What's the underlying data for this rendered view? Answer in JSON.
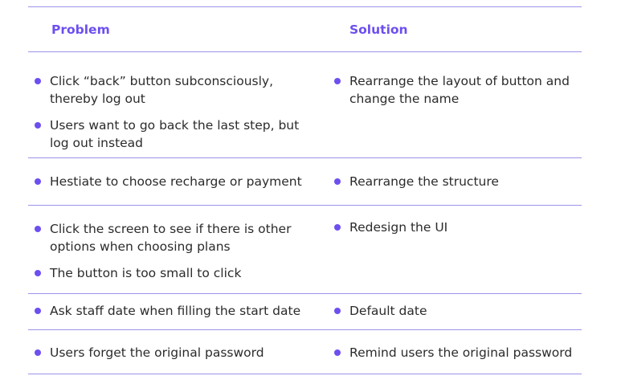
{
  "header": {
    "problem": "Problem",
    "solution": "Solution"
  },
  "rows": [
    {
      "problems": [
        "Click “back” button subconsciously, thereby log out",
        "Users want to go back the last step, but log out instead"
      ],
      "solutions": [
        "Rearrange the layout of button and change the name"
      ]
    },
    {
      "problems": [
        "Hestiate to choose recharge or payment"
      ],
      "solutions": [
        "Rearrange the structure"
      ]
    },
    {
      "problems": [
        "Click the screen to see if there is other options when choosing plans",
        "The button is too small to click"
      ],
      "solutions": [
        "Redesign the UI"
      ]
    },
    {
      "problems": [
        "Ask staff date when filling the start date"
      ],
      "solutions": [
        "Default date"
      ]
    },
    {
      "problems": [
        "Users forget the original password"
      ],
      "solutions": [
        "Remind users the original password"
      ]
    }
  ],
  "colors": {
    "accent": "#6d4ff0",
    "rule": "#9b93e8",
    "text": "#2b2b2b"
  }
}
